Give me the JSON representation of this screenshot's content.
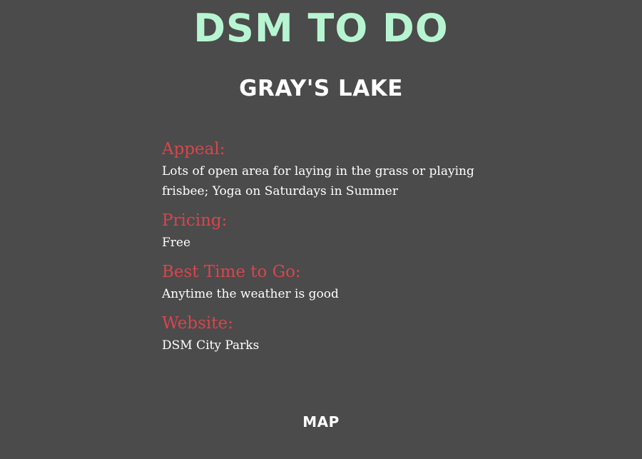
{
  "header": {
    "site_title": "DSM TO DO"
  },
  "place": {
    "title": "GRAY'S LAKE"
  },
  "sections": [
    {
      "heading": "Appeal:",
      "text": "Lots of open area for laying in the grass or playing frisbee; Yoga on Saturdays in Summer"
    },
    {
      "heading": "Pricing:",
      "text": "Free"
    },
    {
      "heading": "Best Time to Go:",
      "text": "Anytime the weather is good"
    },
    {
      "heading": "Website:",
      "text": "DSM City Parks"
    }
  ],
  "footer": {
    "map_label": "MAP"
  },
  "colors": {
    "background": "#4b4b4b",
    "title_accent": "#b7f5d2",
    "heading_red": "#d9454d",
    "text": "#ffffff"
  }
}
